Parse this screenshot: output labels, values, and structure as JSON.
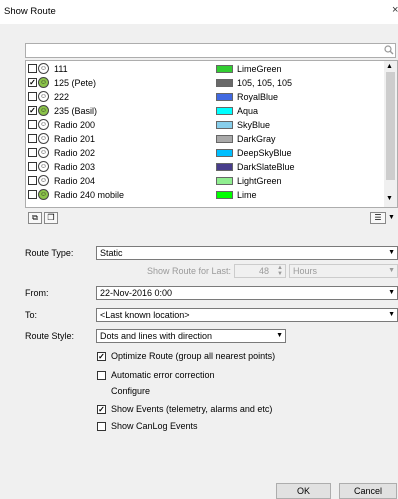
{
  "window": {
    "title": "Show Route",
    "close_glyph": "×"
  },
  "icons": {
    "search": "search-icon",
    "route": "runner-icon",
    "list_menu": "list-menu-icon",
    "expand": "expand-all-icon",
    "collapse": "collapse-all-icon"
  },
  "colors": {
    "accent": "#0078d7",
    "selected_icon": "#8bc34a"
  },
  "routes": [
    {
      "checked": false,
      "name": "111",
      "icon_active": false,
      "color_name": "LimeGreen",
      "color": "#32cd32"
    },
    {
      "checked": true,
      "name": "125 (Pete)",
      "icon_active": true,
      "color_name": "105, 105, 105",
      "color": "#696969"
    },
    {
      "checked": false,
      "name": "222",
      "icon_active": false,
      "color_name": "RoyalBlue",
      "color": "#4169e1"
    },
    {
      "checked": true,
      "name": "235 (Basil)",
      "icon_active": true,
      "color_name": "Aqua",
      "color": "#00ffff"
    },
    {
      "checked": false,
      "name": "Radio 200",
      "icon_active": false,
      "color_name": "SkyBlue",
      "color": "#87ceeb"
    },
    {
      "checked": false,
      "name": "Radio 201",
      "icon_active": false,
      "color_name": "DarkGray",
      "color": "#a9a9a9"
    },
    {
      "checked": false,
      "name": "Radio 202",
      "icon_active": false,
      "color_name": "DeepSkyBlue",
      "color": "#00bfff"
    },
    {
      "checked": false,
      "name": "Radio 203",
      "icon_active": false,
      "color_name": "DarkSlateBlue",
      "color": "#483d8b"
    },
    {
      "checked": false,
      "name": "Radio 204",
      "icon_active": false,
      "color_name": "LightGreen",
      "color": "#90ee90"
    },
    {
      "checked": false,
      "name": "Radio 240 mobile",
      "icon_active": true,
      "color_name": "Lime",
      "color": "#00ff00"
    }
  ],
  "form": {
    "route_type_label": "Route Type:",
    "route_type_value": "Static",
    "show_route_for_label": "Show Route for Last:",
    "show_route_for_value": "48",
    "show_route_for_unit": "Hours",
    "from_label": "From:",
    "from_value": "22-Nov-2016 0:00",
    "to_label": "To:",
    "to_value": "<Last known location>",
    "route_style_label": "Route Style:",
    "route_style_value": "Dots and lines with direction",
    "optimize_label": "Optimize Route (group all nearest points)",
    "optimize_checked": true,
    "auto_error_label": "Automatic error correction",
    "auto_error_checked": false,
    "configure_label": "Configure",
    "show_events_label": "Show Events (telemetry, alarms and etc)",
    "show_events_checked": true,
    "show_canlog_label": "Show CanLog Events",
    "show_canlog_checked": false
  },
  "buttons": {
    "ok": "OK",
    "cancel": "Cancel"
  }
}
